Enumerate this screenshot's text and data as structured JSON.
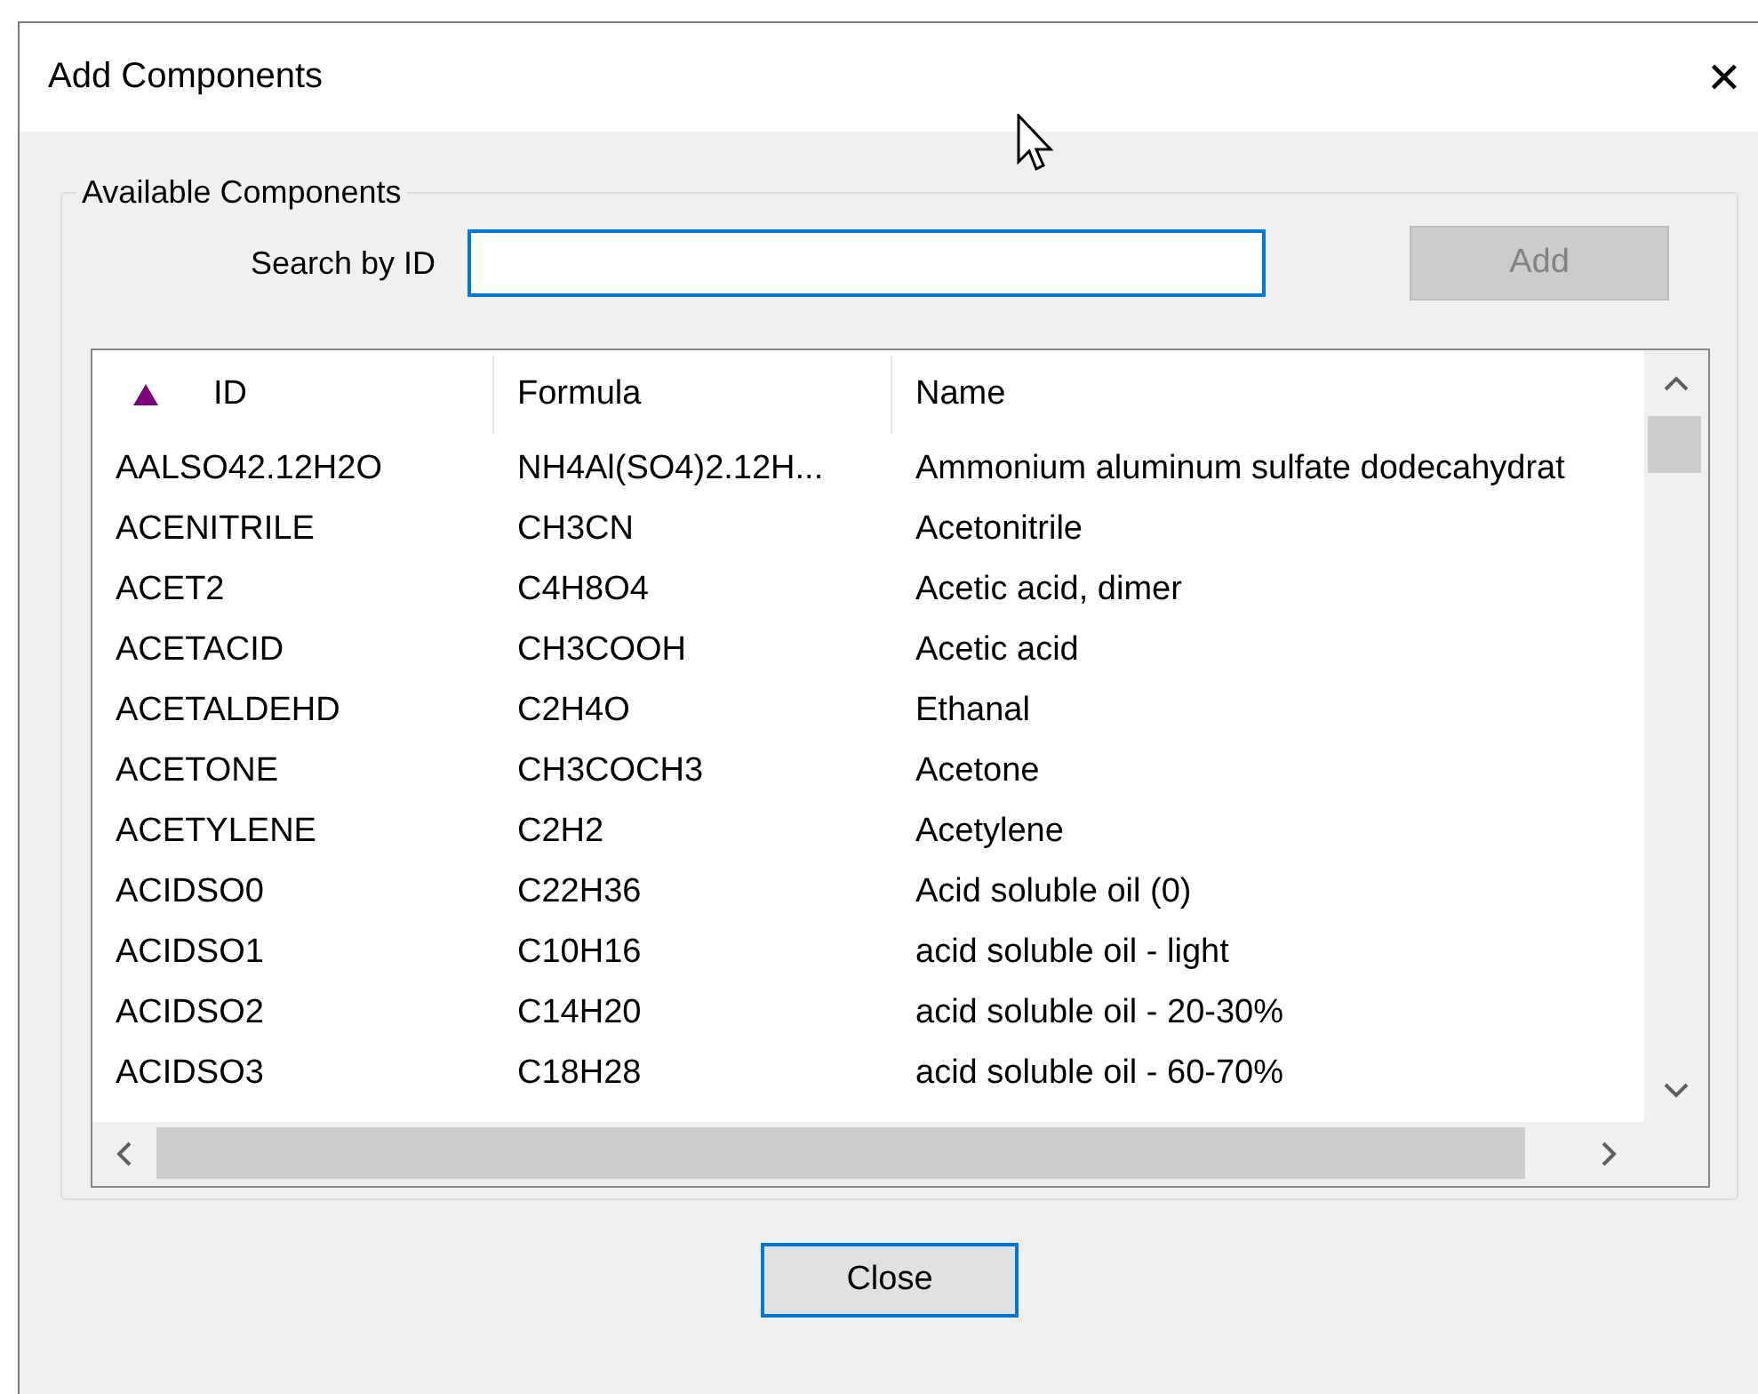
{
  "window": {
    "title": "Add Components",
    "close_glyph": "✕"
  },
  "group": {
    "title": "Available Components"
  },
  "search": {
    "label": "Search by ID",
    "focused": true
  },
  "add_button": {
    "label": "Add",
    "disabled": true
  },
  "table": {
    "columns": [
      {
        "label": "ID",
        "sorted": true
      },
      {
        "label": "Formula",
        "sorted": false
      },
      {
        "label": "Name",
        "sorted": false
      }
    ],
    "rows": [
      [
        "AALSO42.12H2O",
        "NH4Al(SO4)2.12H...",
        "Ammonium aluminum sulfate dodecahydrat"
      ],
      [
        "ACENITRILE",
        "CH3CN",
        "Acetonitrile"
      ],
      [
        "ACET2",
        "C4H8O4",
        "Acetic acid, dimer"
      ],
      [
        "ACETACID",
        "CH3COOH",
        "Acetic acid"
      ],
      [
        "ACETALDEHD",
        "C2H4O",
        "Ethanal"
      ],
      [
        "ACETONE",
        "CH3COCH3",
        "Acetone"
      ],
      [
        "ACETYLENE",
        "C2H2",
        "Acetylene"
      ],
      [
        "ACIDSO0",
        "C22H36",
        "Acid soluble oil (0)"
      ],
      [
        "ACIDSO1",
        "C10H16",
        "acid soluble oil - light"
      ],
      [
        "ACIDSO2",
        "C14H20",
        "acid soluble oil - 20-30%"
      ],
      [
        "ACIDSO3",
        "C18H28",
        "acid soluble oil - 60-70%"
      ]
    ]
  },
  "close_button": {
    "label": "Close",
    "default": true
  }
}
